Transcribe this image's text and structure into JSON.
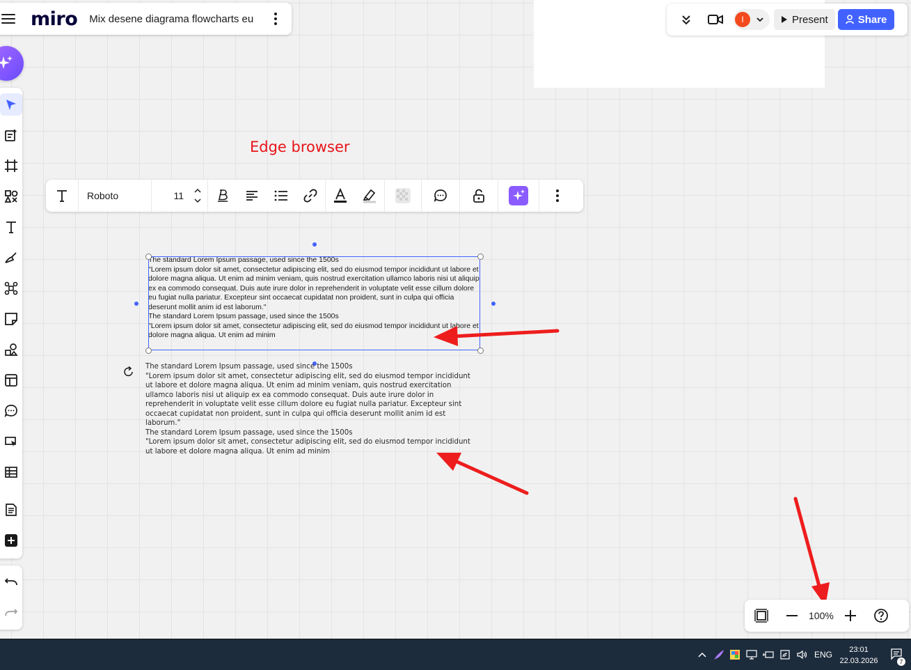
{
  "app": {
    "logo": "miro",
    "board_name": "Mix desene diagrama flowcharts eu"
  },
  "header": {
    "avatar_initial": "I",
    "present_label": "Present",
    "share_label": "Share"
  },
  "context_toolbar": {
    "font_name": "Roboto",
    "font_size": "11"
  },
  "annotation": {
    "text": "Edge browser"
  },
  "text_block_1": "The standard Lorem Ipsum passage, used since the 1500s\n\"Lorem ipsum dolor sit amet, consectetur adipiscing elit, sed do eiusmod tempor incididunt ut labore et dolore magna aliqua. Ut enim ad minim veniam, quis nostrud exercitation ullamco laboris nisi ut aliquip ex ea commodo consequat. Duis aute irure dolor in reprehenderit in voluptate velit esse cillum dolore eu fugiat nulla pariatur. Excepteur sint occaecat cupidatat non proident, sunt in culpa qui officia deserunt mollit anim id est laborum.\"\nThe standard Lorem Ipsum passage, used since the 1500s\n\"Lorem ipsum dolor sit amet, consectetur adipiscing elit, sed do eiusmod tempor incididunt ut labore et dolore magna aliqua. Ut enim ad minim",
  "text_block_2": "The standard Lorem Ipsum passage, used since the 1500s\n\"Lorem ipsum dolor sit amet, consectetur adipiscing elit, sed do eiusmod tempor incididunt ut labore et dolore magna aliqua. Ut enim ad minim veniam, quis nostrud exercitation ullamco laboris nisi ut aliquip ex ea commodo consequat. Duis aute irure dolor in reprehenderit in voluptate velit esse cillum dolore eu fugiat nulla pariatur. Excepteur sint occaecat cupidatat non proident, sunt in culpa qui officia deserunt mollit anim id est laborum.\"\nThe standard Lorem Ipsum passage, used since the 1500s\n\"Lorem ipsum dolor sit amet, consectetur adipiscing elit, sed do eiusmod tempor incididunt ut labore et dolore magna aliqua. Ut enim ad minim",
  "zoom": {
    "value": "100%"
  },
  "taskbar": {
    "language": "ENG",
    "time": "23:01",
    "date": "22.03.2026",
    "notification_count": "7"
  },
  "colors": {
    "accent": "#4262ff",
    "annotation_red": "#e8141a",
    "avatar": "#f34a1d"
  },
  "icons": {
    "left_toolbar": [
      "select-icon",
      "templates-icon",
      "frame-icon",
      "shapes-icon",
      "text-icon",
      "pen-icon",
      "mindmap-icon",
      "sticky-note-icon",
      "diagram-icon",
      "layout-icon",
      "comment-icon",
      "interactive-icon",
      "table-icon",
      "doc-icon",
      "add-icon"
    ],
    "history": [
      "undo-icon",
      "redo-icon"
    ]
  }
}
